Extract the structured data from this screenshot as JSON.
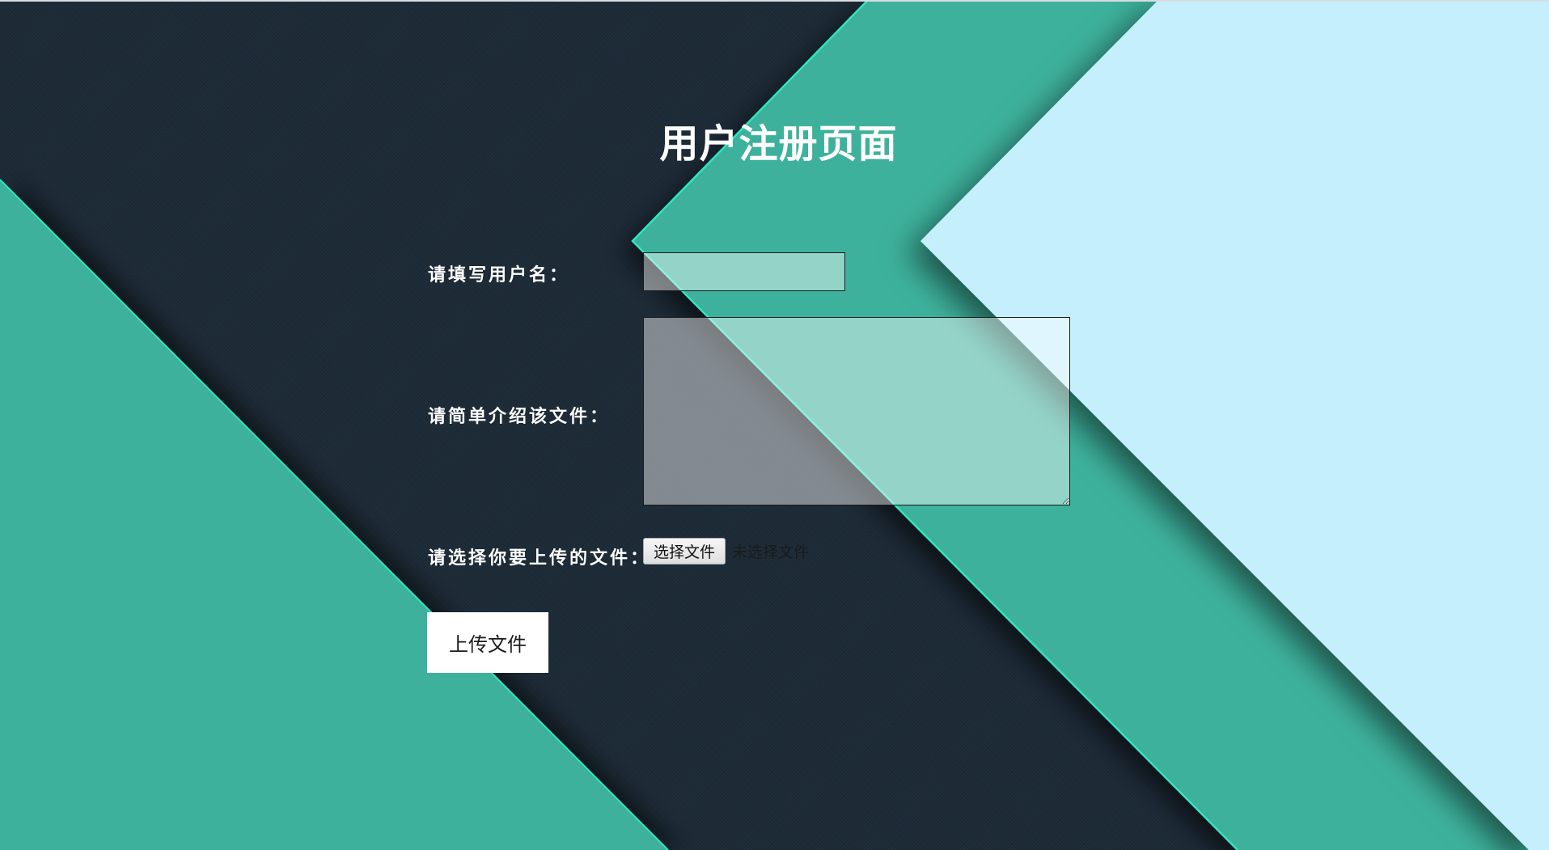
{
  "page": {
    "title": "用户注册页面"
  },
  "form": {
    "username_label": "请填写用户名：",
    "username_value": "",
    "description_label": "请简单介绍该文件：",
    "description_value": "",
    "file_label": "请选择你要上传的文件：",
    "file_button_label": "选择文件",
    "file_status": "未选择文件",
    "submit_label": "上传文件"
  },
  "colors": {
    "background_dark": "#1d2b38",
    "teal": "#3db19c",
    "teal_edge": "#2ee6c0",
    "light_blue": "#c6effd",
    "text_white": "#ffffff"
  }
}
